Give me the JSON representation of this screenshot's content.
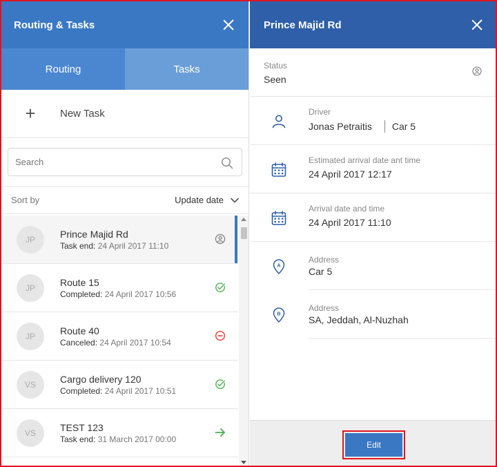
{
  "left_panel": {
    "title": "Routing & Tasks",
    "tabs": [
      {
        "label": "Routing"
      },
      {
        "label": "Tasks"
      }
    ],
    "new_task_label": "New Task",
    "search": {
      "placeholder": "Search",
      "value": ""
    },
    "sort": {
      "label": "Sort by",
      "value": "Update date"
    },
    "tasks": [
      {
        "initials": "JP",
        "title": "Prince Majid Rd",
        "sub_label": "Task end:",
        "date": "24 April 2017 11:10",
        "status_icon": "seen-icon"
      },
      {
        "initials": "JP",
        "title": "Route 15",
        "sub_label": "Completed:",
        "date": "24 April 2017 10:56",
        "status_icon": "check-circle-icon"
      },
      {
        "initials": "JP",
        "title": "Route 40",
        "sub_label": "Canceled:",
        "date": "24 April 2017 10:54",
        "status_icon": "cancel-circle-icon"
      },
      {
        "initials": "VS",
        "title": "Cargo delivery 120",
        "sub_label": "Completed:",
        "date": "24 April 2017 10:51",
        "status_icon": "check-circle-icon"
      },
      {
        "initials": "VS",
        "title": "TEST 123",
        "sub_label": "Task end:",
        "date": "31 March 2017 00:00",
        "status_icon": "arrow-right-icon"
      }
    ]
  },
  "right_panel": {
    "title": "Prince Majid Rd",
    "status": {
      "label": "Status",
      "value": "Seen"
    },
    "driver": {
      "label": "Driver",
      "name": "Jonas Petraitis",
      "car": "Car 5"
    },
    "estimated_arrival": {
      "label": "Estimated arrival date ant time",
      "value": "24 April 2017 12:17"
    },
    "arrival": {
      "label": "Arrival date and time",
      "value": "24 April 2017 11:10"
    },
    "address_a": {
      "label": "Address",
      "value": "Car 5",
      "marker": "A"
    },
    "address_b": {
      "label": "Address",
      "value": "SA, Jeddah, Al-Nuzhah",
      "marker": "B"
    },
    "edit_label": "Edit"
  },
  "colors": {
    "left_header": "#3b78c4",
    "right_header": "#2e5fa8",
    "tab_routing": "#4a87d0",
    "tab_tasks": "#6a9ed9",
    "icon_blue": "#2e5fa8",
    "success_green": "#4caf50",
    "cancel_red": "#e53935",
    "highlight_red": "#e0141e"
  }
}
